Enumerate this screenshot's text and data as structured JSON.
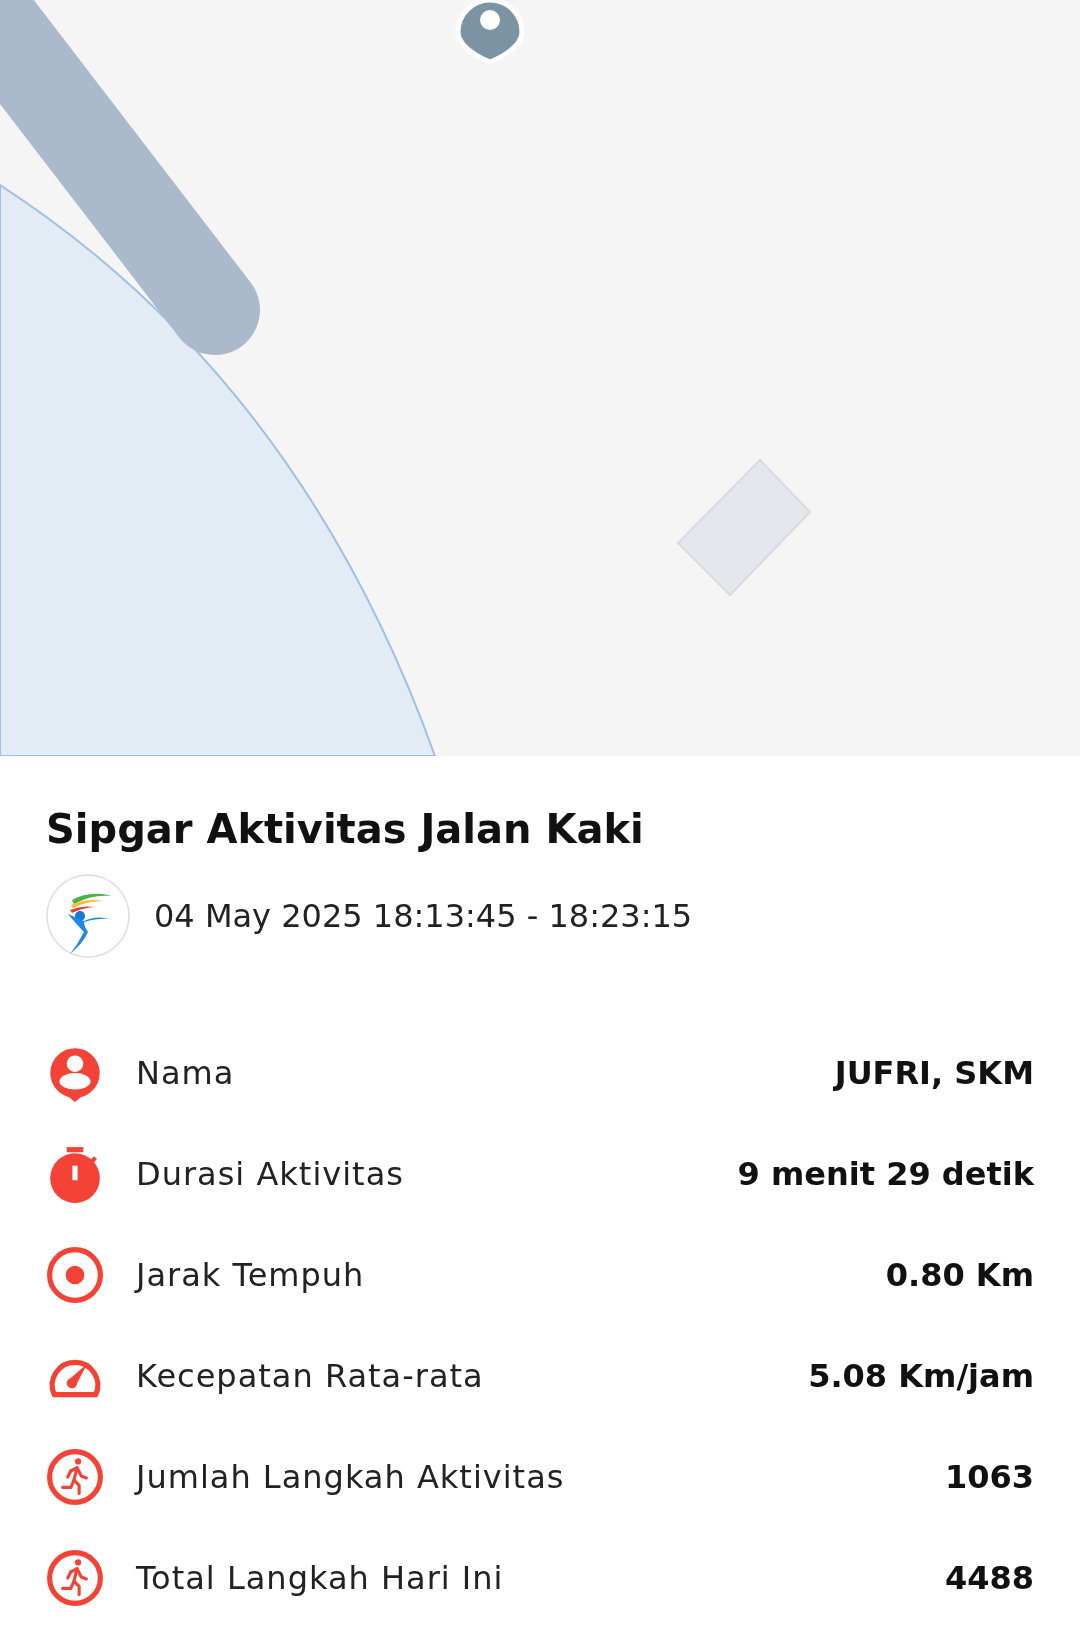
{
  "title": "Sipgar Aktivitas Jalan Kaki",
  "date_range": "04 May 2025 18:13:45 - 18:23:15",
  "stats": [
    {
      "kind": "person",
      "label": "Nama",
      "value": "JUFRI, SKM"
    },
    {
      "kind": "timer",
      "label": "Durasi Aktivitas",
      "value": "9 menit 29 detik"
    },
    {
      "kind": "target",
      "label": "Jarak Tempuh",
      "value": "0.80 Km"
    },
    {
      "kind": "speed",
      "label": "Kecepatan Rata-rata",
      "value": "5.08 Km/jam"
    },
    {
      "kind": "steps",
      "label": "Jumlah Langkah Aktivitas",
      "value": "1063"
    },
    {
      "kind": "steps",
      "label": "Total Langkah Hari Ini",
      "value": "4488"
    }
  ]
}
